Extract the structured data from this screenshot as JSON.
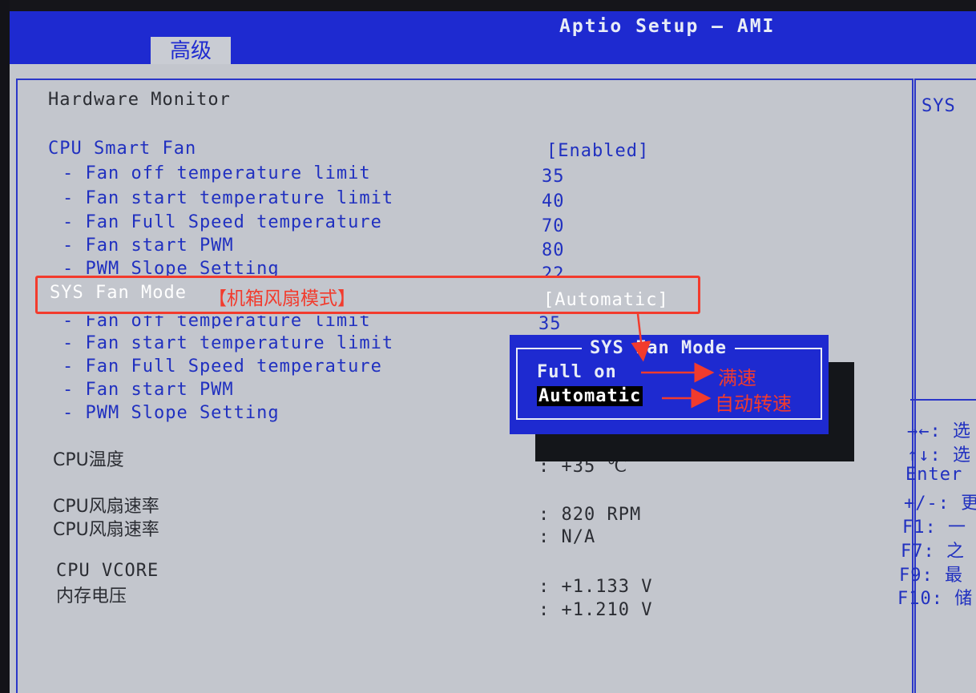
{
  "header": {
    "title": "Aptio Setup – AMI",
    "tab": "高级"
  },
  "section_title": "Hardware Monitor",
  "cpu_fan": {
    "label": "CPU Smart Fan",
    "value": "[Enabled]",
    "items": [
      {
        "label": "- Fan off temperature limit",
        "value": "35"
      },
      {
        "label": "- Fan start temperature limit",
        "value": "40"
      },
      {
        "label": "- Fan Full Speed temperature",
        "value": "70"
      },
      {
        "label": "- Fan start PWM",
        "value": "80"
      },
      {
        "label": "- PWM Slope Setting",
        "value": "22"
      }
    ]
  },
  "sys_fan": {
    "label": "SYS Fan Mode",
    "annotation": "【机箱风扇模式】",
    "value": "[Automatic]",
    "items": [
      {
        "label": "- Fan off temperature limit",
        "value": "35"
      },
      {
        "label": "- Fan start temperature limit"
      },
      {
        "label": "- Fan Full Speed temperature"
      },
      {
        "label": "- Fan start PWM"
      },
      {
        "label": "- PWM Slope Setting"
      }
    ]
  },
  "monitor": {
    "cpu_temp": {
      "label": "CPU温度",
      "value": ": +35 ℃"
    },
    "cpu_fan_speed": {
      "label": "CPU风扇速率",
      "value": ": 820 RPM"
    },
    "cpu_fan_speed2": {
      "label": "CPU风扇速率",
      "value": ": N/A"
    },
    "cpu_vcore": {
      "label": "CPU VCORE",
      "value": ": +1.133 V"
    },
    "mem_voltage": {
      "label": "内存电压",
      "value": ": +1.210 V"
    }
  },
  "popup": {
    "title": "SYS Fan Mode",
    "options": [
      {
        "label": "Full on",
        "annotation": "满速"
      },
      {
        "label": "Automatic",
        "annotation": "自动转速",
        "selected": true
      }
    ]
  },
  "help": {
    "title": "SYS",
    "keys": [
      "→←: 选",
      "↑↓: 选",
      "Enter",
      "+/-: 更",
      "F1: 一",
      "F7: 之",
      "F9: 最",
      "F10: 储"
    ]
  },
  "colors": {
    "bios_blue": "#1e2ad0",
    "panel_gray": "#c3c6cd",
    "annotation_red": "#f23b2d"
  }
}
